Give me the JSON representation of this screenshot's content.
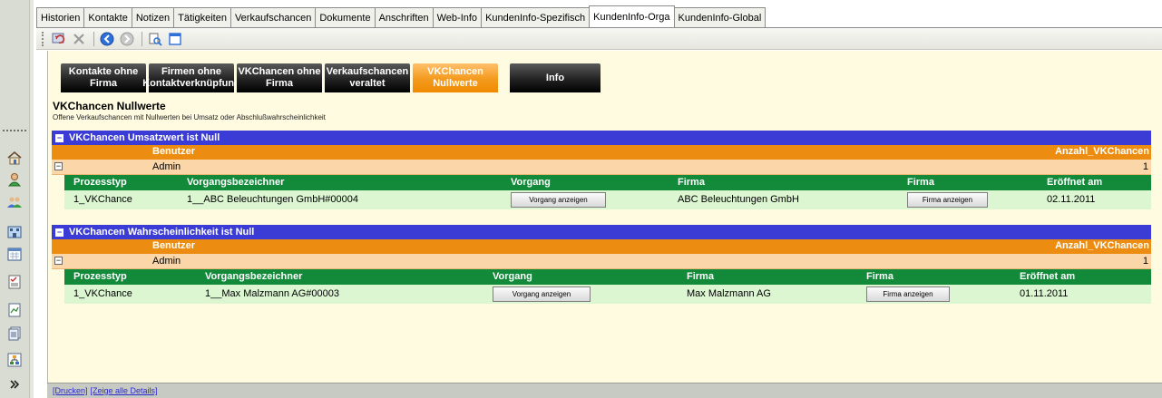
{
  "tabs": [
    {
      "label": "Historien"
    },
    {
      "label": "Kontakte"
    },
    {
      "label": "Notizen"
    },
    {
      "label": "Tätigkeiten"
    },
    {
      "label": "Verkaufschancen"
    },
    {
      "label": "Dokumente"
    },
    {
      "label": "Anschriften"
    },
    {
      "label": "Web-Info"
    },
    {
      "label": "KundenInfo-Spezifisch"
    },
    {
      "label": "KundenInfo-Orga"
    },
    {
      "label": "KundenInfo-Global"
    }
  ],
  "toolbar": {
    "icons": [
      "refresh-icon",
      "delete-icon",
      "back-icon",
      "forward-icon",
      "preview-icon",
      "window-icon"
    ]
  },
  "nav_buttons": {
    "line1": [
      "Kontakte ohne",
      "Firmen ohne",
      "VKChancen ohne",
      "Verkaufschancen",
      "VKChancen",
      "Info"
    ],
    "line2": [
      "Firma",
      "Kontaktverknüpfung",
      "Firma",
      "veraltet",
      "Nullwerte",
      ""
    ]
  },
  "section": {
    "title": "VKChancen Nullwerte",
    "subtitle": "Offene Verkaufschancen mit Nullwerten bei Umsatz oder Abschlußwahrscheinlichkeit"
  },
  "groups": [
    {
      "title": "VKChancen Umsatzwert ist Null",
      "user_header": "Benutzer",
      "count_header": "Anzahl_VKChancen",
      "user": "Admin",
      "count": "1",
      "columns": [
        "Prozesstyp",
        "Vorgangsbezeichner",
        "Vorgang",
        "Firma",
        "Firma",
        "Eröffnet am"
      ],
      "row": {
        "prozesstyp": "1_VKChance",
        "vorgangsbezeichner": "1__ABC Beleuchtungen GmbH#00004",
        "vorgang_button": "Vorgang anzeigen",
        "firma": "ABC Beleuchtungen GmbH",
        "firma_button": "Firma anzeigen",
        "eroeffnet": "02.11.2011"
      }
    },
    {
      "title": "VKChancen Wahrscheinlichkeit ist Null",
      "user_header": "Benutzer",
      "count_header": "Anzahl_VKChancen",
      "user": "Admin",
      "count": "1",
      "columns": [
        "Prozesstyp",
        "Vorgangsbezeichner",
        "Vorgang",
        "Firma",
        "Firma",
        "Eröffnet am"
      ],
      "row": {
        "prozesstyp": "1_VKChance",
        "vorgangsbezeichner": "1__Max Malzmann AG#00003",
        "vorgang_button": "Vorgang anzeigen",
        "firma": "Max Malzmann AG",
        "firma_button": "Firma anzeigen",
        "eroeffnet": "01.11.2011"
      }
    }
  ],
  "footer": {
    "print_link": "[Drucken]",
    "details_link": "[Zeige alle Details]"
  },
  "colors": {
    "group_header": "#3b3bd6",
    "user_header": "#ec8d12",
    "detail_header": "#128a3a",
    "active_button": "#f39a1d"
  }
}
